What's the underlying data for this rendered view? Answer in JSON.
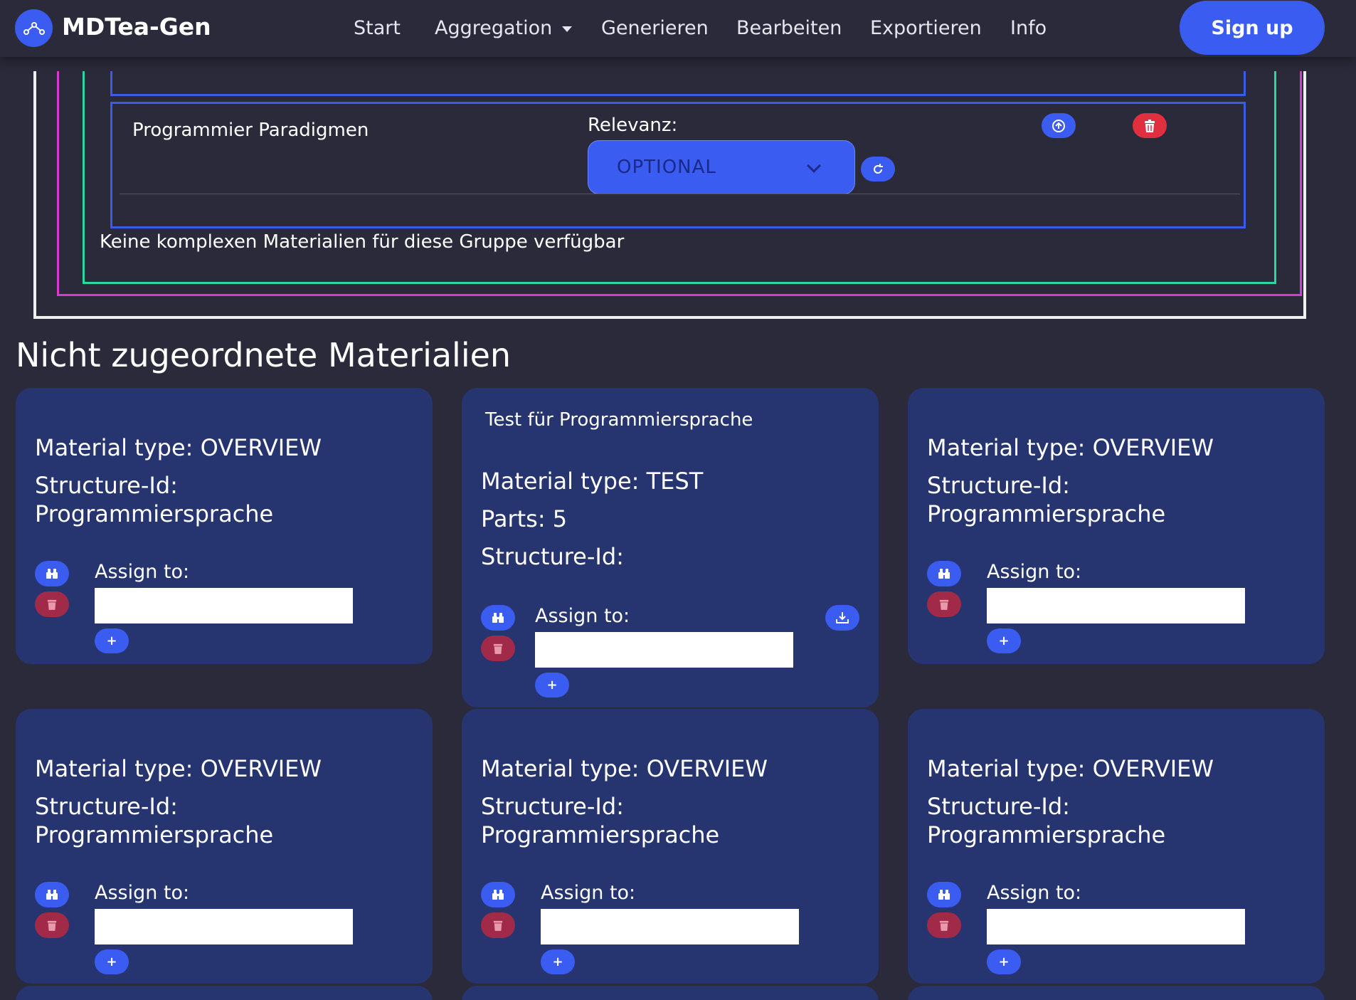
{
  "navbar": {
    "brand": "MDTea-Gen",
    "links": [
      "Start",
      "Aggregation",
      "Generieren",
      "Bearbeiten",
      "Exportieren",
      "Info"
    ],
    "signup": "Sign up"
  },
  "structure": {
    "node_title": "Programmier Paradigmen",
    "relevanz_label": "Relevanz:",
    "relevanz_value": "OPTIONAL",
    "no_complex_materials": "Keine komplexen Materialien für diese Gruppe verfügbar"
  },
  "section_heading": "Nicht zugeordnete Materialien",
  "assign_label": "Assign to:",
  "plus_label": "+",
  "cards": [
    {
      "header": "",
      "lines": [
        "Material type: OVERVIEW",
        "Structure-Id:",
        "Programmiersprache"
      ]
    },
    {
      "header": "Test für Programmiersprache",
      "lines": [
        "Material type: TEST",
        "Parts: 5",
        "Structure-Id:"
      ]
    },
    {
      "header": "",
      "lines": [
        "Material type: OVERVIEW",
        "Structure-Id:",
        "Programmiersprache"
      ]
    },
    {
      "header": "",
      "lines": [
        "Material type: OVERVIEW",
        "Structure-Id:",
        "Programmiersprache"
      ]
    },
    {
      "header": "",
      "lines": [
        "Material type: OVERVIEW",
        "Structure-Id:",
        "Programmiersprache"
      ]
    },
    {
      "header": "",
      "lines": [
        "Material type: OVERVIEW",
        "Structure-Id:",
        "Programmiersprache"
      ]
    }
  ],
  "icons": {
    "logo": "network-icon",
    "move_up": "arrow-up-circle-icon",
    "delete": "trash-icon",
    "reset": "refresh-icon",
    "view": "binoculars-icon",
    "download": "download-icon",
    "dropdown": "chevron-down-icon"
  },
  "colors": {
    "background": "#2a2a3a",
    "primary": "#3b5cf0",
    "danger": "#e03040",
    "card": "#263470",
    "frame_pink": "#d63ad0",
    "frame_green": "#2ad8a0",
    "frame_blue": "#3a5ce8"
  }
}
